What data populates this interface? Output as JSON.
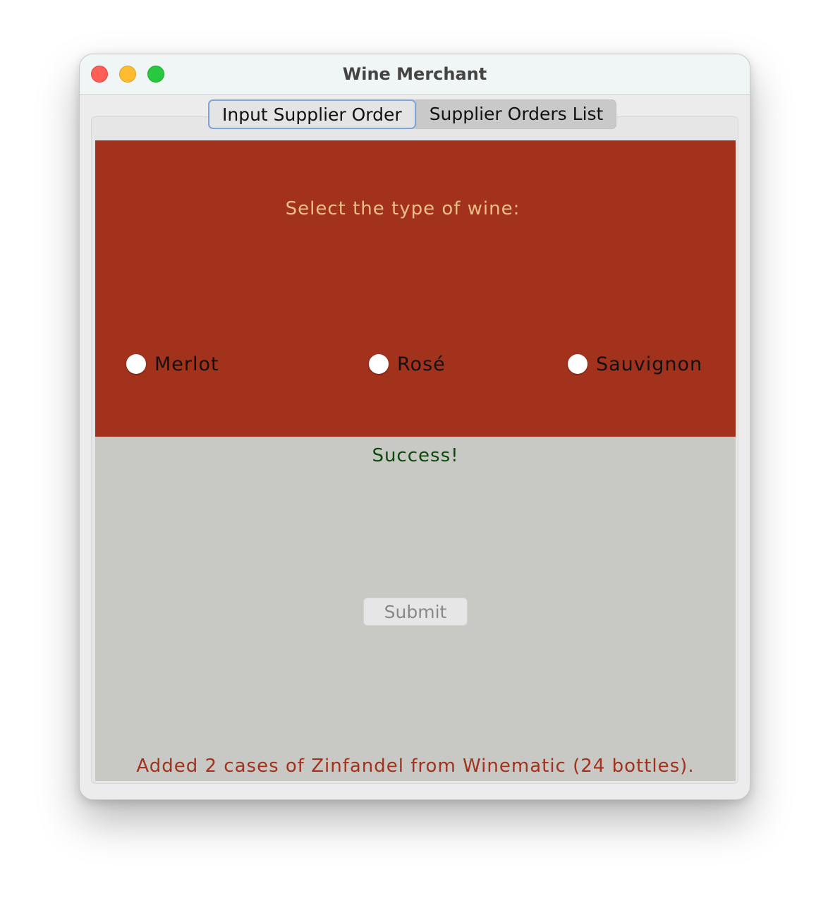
{
  "window": {
    "title": "Wine Merchant"
  },
  "tabs": [
    {
      "label": "Input Supplier Order",
      "active": true
    },
    {
      "label": "Supplier Orders List",
      "active": false
    }
  ],
  "wine_selection": {
    "prompt": "Select the type of wine:",
    "options": [
      {
        "label": "Merlot",
        "selected": false
      },
      {
        "label": "Rosé",
        "selected": false
      },
      {
        "label": "Sauvignon",
        "selected": false
      }
    ]
  },
  "status": {
    "text": "Success!"
  },
  "submit": {
    "label": "Submit",
    "enabled": false
  },
  "message": {
    "text": "Added 2 cases of Zinfandel from Winematic (24 bottles)."
  },
  "colors": {
    "wine_panel_bg": "#a3321c",
    "prompt_text": "#e9bd88",
    "success_text": "#0c4a0c",
    "message_text": "#a3321c",
    "bottom_panel_bg": "#c8c8c4"
  }
}
